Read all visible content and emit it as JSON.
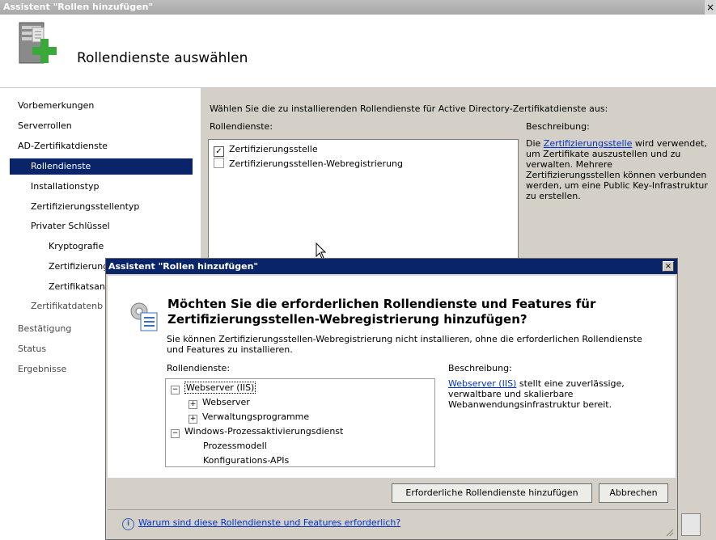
{
  "window": {
    "title": "Assistent \"Rollen hinzufügen\"",
    "close_glyph": "×"
  },
  "header": {
    "title": "Rollendienste auswählen",
    "icon": "server-add-icon"
  },
  "nav": {
    "items": [
      {
        "label": "Vorbemerkungen"
      },
      {
        "label": "Serverrollen"
      },
      {
        "label": "AD-Zertifikatdienste"
      },
      {
        "label": "Rollendienste"
      },
      {
        "label": "Installationstyp"
      },
      {
        "label": "Zertifizierungsstellentyp"
      },
      {
        "label": "Privater Schlüssel"
      },
      {
        "label": "Kryptografie"
      },
      {
        "label": "Zertifizierung"
      },
      {
        "label": "Zertifikatsan"
      },
      {
        "label": "Zertifikatdatenb"
      },
      {
        "label": "Bestätigung"
      },
      {
        "label": "Status"
      },
      {
        "label": "Ergebnisse"
      }
    ]
  },
  "main": {
    "intro": "Wählen Sie die zu installierenden Rollendienste für Active Directory-Zertifikatdienste aus:",
    "role_services_label": "Rollendienste:",
    "description_label": "Beschreibung:",
    "role_services": [
      {
        "label": "Zertifizierungsstelle",
        "checked": "✓"
      },
      {
        "label": "Zertifizierungsstellen-Webregistrierung",
        "checked": ""
      }
    ],
    "description": {
      "prefix": "Die ",
      "link": "Zertifizierungsstelle",
      "suffix": " wird verwendet, um Zertifikate auszustellen und zu verwalten. Mehrere Zertifizierungsstellen können verbunden werden, um eine Public Key-Infrastruktur zu erstellen."
    }
  },
  "dialog": {
    "title": "Assistent \"Rollen hinzufügen\"",
    "close_glyph": "×",
    "question": "Möchten Sie die erforderlichen Rollendienste und Features für Zertifizierungsstellen-Webregistrierung hinzufügen?",
    "explain": "Sie können Zertifizierungsstellen-Webregistrierung nicht installieren, ohne die erforderlichen Rollendienste und Features zu installieren.",
    "role_services_label": "Rollendienste:",
    "description_label": "Beschreibung:",
    "tree": [
      {
        "label": "Webserver (IIS)",
        "expander": "−"
      },
      {
        "label": "Webserver",
        "expander": "+"
      },
      {
        "label": "Verwaltungsprogramme",
        "expander": "+"
      },
      {
        "label": "Windows-Prozessaktivierungsdienst",
        "expander": "−"
      },
      {
        "label": "Prozessmodell",
        "expander": ""
      },
      {
        "label": "Konfigurations-APIs",
        "expander": ""
      }
    ],
    "description": {
      "link": "Webserver (IIS)",
      "suffix": " stellt eine zuverlässige, verwaltbare und skalierbare Webanwendungsinfrastruktur bereit."
    },
    "buttons": {
      "add": "Erforderliche Rollendienste hinzufügen",
      "cancel": "Abbrechen"
    },
    "info_glyph": "i",
    "why_link": "Warum sind diese Rollendienste und Features erforderlich?"
  }
}
